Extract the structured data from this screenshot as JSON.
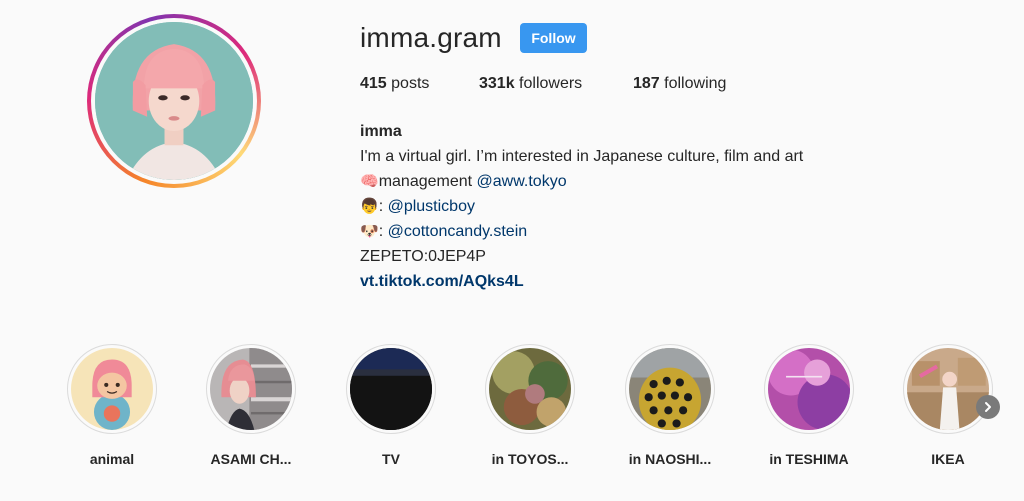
{
  "profile": {
    "username": "imma.gram",
    "follow_label": "Follow",
    "stats": {
      "posts_count": "415",
      "posts_label": "posts",
      "followers_count": "331k",
      "followers_label": "followers",
      "following_count": "187",
      "following_label": "following"
    },
    "bio": {
      "name": "imma",
      "line1": "I'm a virtual girl. I’m interested in Japanese culture, film and art",
      "line2_emoji": "🧠",
      "line2_text": "management ",
      "line2_mention": "@aww.tokyo",
      "line3_emoji": "👦",
      "line3_text": ": ",
      "line3_mention": "@plusticboy",
      "line4_emoji": "🐶",
      "line4_text": ": ",
      "line4_mention": "@cottoncandy.stein",
      "line5": "ZEPETO:0JEP4P",
      "link": "vt.tiktok.com/AQks4L"
    }
  },
  "highlights": [
    {
      "label": "animal"
    },
    {
      "label": "ASAMI CH..."
    },
    {
      "label": "TV"
    },
    {
      "label": "in TOYOS..."
    },
    {
      "label": "in NAOSHI..."
    },
    {
      "label": "in TESHIMA"
    },
    {
      "label": "IKEA"
    }
  ],
  "colors": {
    "accent": "#3897f0",
    "link": "#00376b",
    "text": "#262626",
    "background": "#fafafa"
  },
  "icons": {
    "next": "chevron-right-icon"
  }
}
